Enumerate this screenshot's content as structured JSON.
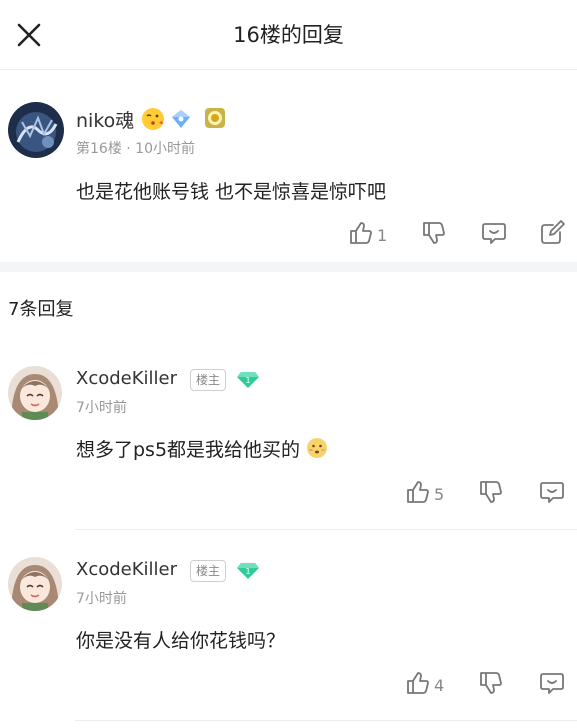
{
  "header": {
    "title": "16楼的回复"
  },
  "main_post": {
    "user_name": "niko魂",
    "meta": "第16楼 · 10小时前",
    "content": "也是花他账号钱 也不是惊喜是惊吓吧",
    "like_count": "1"
  },
  "replies_header": {
    "count_label": "7条回复"
  },
  "replies": [
    {
      "user_name": "XcodeKiller",
      "badge": "楼主",
      "time": "7小时前",
      "content": "想多了ps5都是我给他买的",
      "like_count": "5"
    },
    {
      "user_name": "XcodeKiller",
      "badge": "楼主",
      "time": "7小时前",
      "content": "你是没有人给你花钱吗？",
      "like_count": "4"
    }
  ],
  "colors": {
    "accent_green": "#2ecc9a",
    "diamond_blue": "#6ab0ff",
    "divider": "#ececec"
  }
}
